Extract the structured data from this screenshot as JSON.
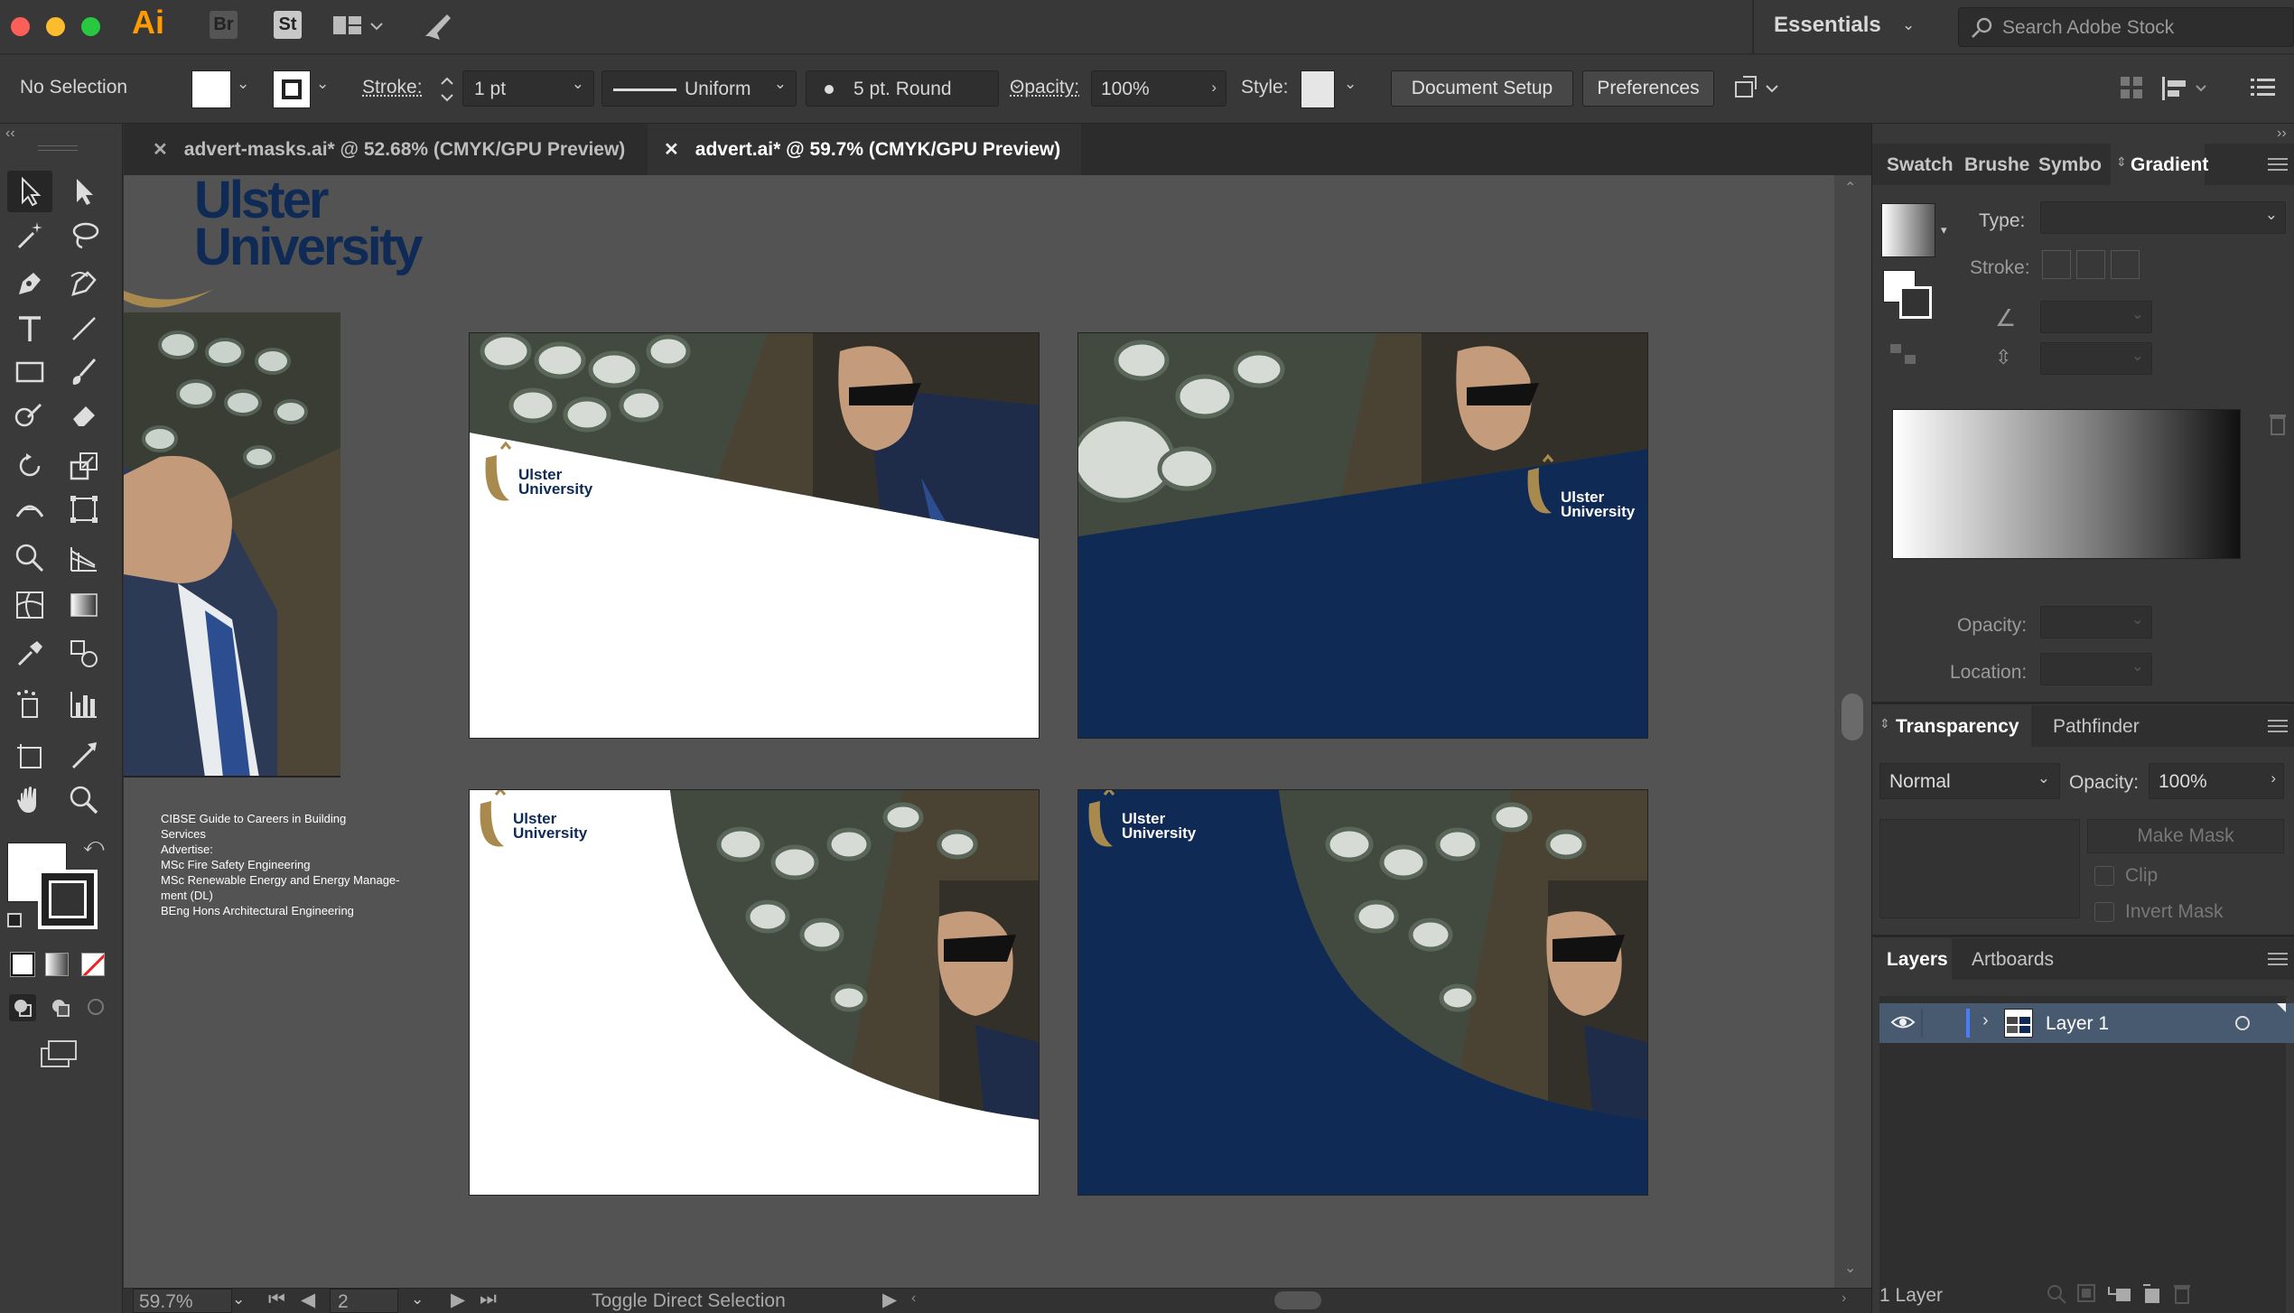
{
  "app": {
    "logo": "Ai",
    "bridge": "Br",
    "stock": "St",
    "workspace": "Essentials",
    "search_placeholder": "Search Adobe Stock"
  },
  "controlbar": {
    "selection": "No Selection",
    "stroke_label": "Stroke:",
    "stroke_value": "1 pt",
    "profile": "Uniform",
    "brush": "5 pt. Round",
    "opacity_label": "Opacity:",
    "opacity_value": "100%",
    "style_label": "Style:",
    "document_setup": "Document Setup",
    "preferences": "Preferences"
  },
  "tabs": [
    {
      "label": "advert-masks.ai* @ 52.68% (CMYK/GPU Preview)",
      "active": false
    },
    {
      "label": "advert.ai* @ 59.7% (CMYK/GPU Preview)",
      "active": true
    }
  ],
  "artwork": {
    "logo_line1": "Ulster",
    "logo_line2": "University",
    "side_title": "CIBSE Guide to Careers in Building Services",
    "side_advertise": "Advertise:",
    "side_items": [
      "MSc Fire Safety Engineering",
      "MSc Renewable Energy and Energy Manage-",
      "ment (DL)",
      "BEng Hons Architectural Engineering"
    ],
    "colors": {
      "navy": "#0f2a55",
      "gold": "#a88a4f",
      "white": "#ffffff"
    }
  },
  "gradient_panel": {
    "tabs": [
      "Swatch",
      "Brushe",
      "Symbo",
      "Gradient"
    ],
    "type_label": "Type:",
    "stroke_label": "Stroke:",
    "opacity_label": "Opacity:",
    "location_label": "Location:"
  },
  "transparency_panel": {
    "tabs": [
      "Transparency",
      "Pathfinder"
    ],
    "blend_mode": "Normal",
    "opacity_label": "Opacity:",
    "opacity_value": "100%",
    "make_mask": "Make Mask",
    "clip": "Clip",
    "invert_mask": "Invert Mask"
  },
  "layers_panel": {
    "tabs": [
      "Layers",
      "Artboards"
    ],
    "layers": [
      {
        "name": "Layer 1"
      }
    ],
    "count": "1 Layer"
  },
  "statusbar": {
    "zoom": "59.7%",
    "artboard": "2",
    "tool_hint": "Toggle Direct Selection"
  }
}
